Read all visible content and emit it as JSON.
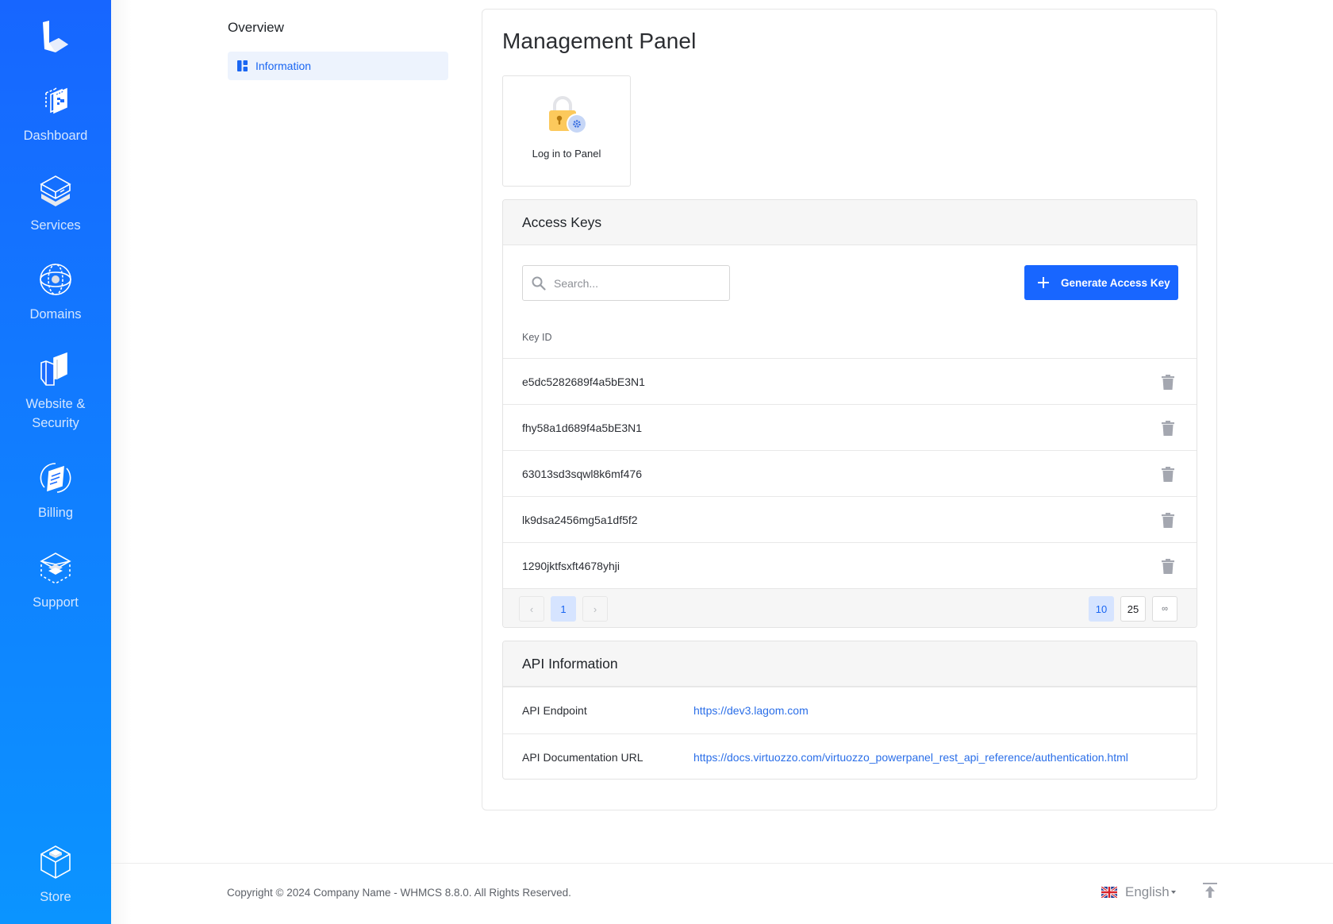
{
  "sidebar": {
    "logo": "lagom-logo",
    "items": [
      {
        "label": "Dashboard",
        "icon": "dashboard-icon"
      },
      {
        "label": "Services",
        "icon": "services-icon"
      },
      {
        "label": "Domains",
        "icon": "globe-icon"
      },
      {
        "label": "Website &\nSecurity",
        "label_line1": "Website &",
        "label_line2": "Security",
        "icon": "website-security-icon"
      },
      {
        "label": "Billing",
        "icon": "billing-icon"
      },
      {
        "label": "Support",
        "icon": "support-icon"
      },
      {
        "label": "Store",
        "icon": "store-icon"
      }
    ]
  },
  "secondary_nav": {
    "title": "Overview",
    "items": [
      {
        "label": "Information",
        "icon": "dashboard-grid-icon",
        "active": true
      }
    ]
  },
  "main": {
    "title": "Management Panel",
    "login_tile": {
      "label": "Log in to Panel",
      "icon": "lock-gear-icon"
    },
    "access_keys": {
      "title": "Access Keys",
      "search_placeholder": "Search...",
      "search_value": "",
      "generate_button": "Generate Access Key",
      "column_header": "Key ID",
      "rows": [
        {
          "key_id": "e5dc5282689f4a5bE3N1"
        },
        {
          "key_id": "fhy58a1d689f4a5bE3N1"
        },
        {
          "key_id": "63013sd3sqwl8k6mf476"
        },
        {
          "key_id": "lk9dsa2456mg5a1df5f2"
        },
        {
          "key_id": "1290jktfsxft4678yhji"
        }
      ],
      "pagination": {
        "prev": "‹",
        "next": "›",
        "pages": [
          "1"
        ],
        "current_page": "1",
        "page_sizes": [
          "10",
          "25",
          "∞"
        ],
        "current_page_size": "10"
      }
    },
    "api_info": {
      "title": "API Information",
      "rows": [
        {
          "label": "API Endpoint",
          "value": "https://dev3.lagom.com"
        },
        {
          "label": "API Documentation URL",
          "value": "https://docs.virtuozzo.com/virtuozzo_powerpanel_rest_api_reference/authentication.html"
        }
      ]
    }
  },
  "footer": {
    "copyright": "Copyright © 2024 Company Name - WHMCS 8.8.0. All Rights Reserved.",
    "language": "English",
    "language_flag": "uk-flag-icon",
    "back_to_top": "arrow-up-to-line-icon"
  },
  "colors": {
    "sidebar_top": "#1766ff",
    "sidebar_bottom": "#0b94ff",
    "primary": "#1866ff",
    "link": "#2a6ee8",
    "active_bg": "#d6e4ff"
  }
}
